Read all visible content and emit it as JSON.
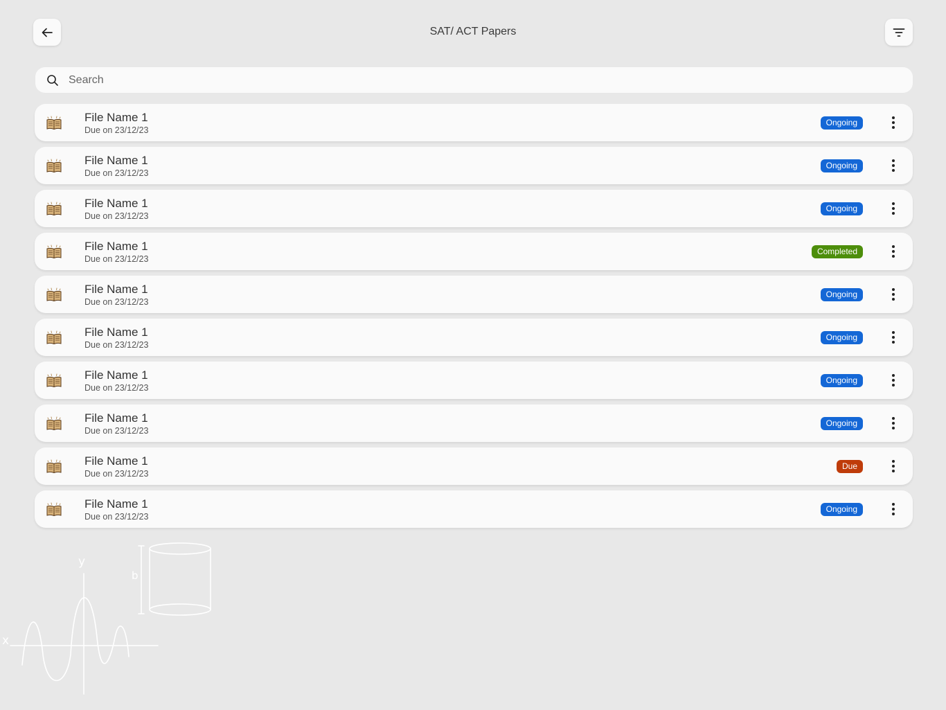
{
  "header": {
    "title": "SAT/ ACT Papers",
    "back_icon": "arrow-left-icon",
    "filter_icon": "filter-icon"
  },
  "search": {
    "placeholder": "Search",
    "value": ""
  },
  "status_colors": {
    "Ongoing": "#1467d6",
    "Completed": "#4d8e0b",
    "Due": "#bf3c0a"
  },
  "files": [
    {
      "name": "File Name 1",
      "due": "Due on 23/12/23",
      "status": "Ongoing"
    },
    {
      "name": "File Name 1",
      "due": "Due on 23/12/23",
      "status": "Ongoing"
    },
    {
      "name": "File Name 1",
      "due": "Due on 23/12/23",
      "status": "Ongoing"
    },
    {
      "name": "File Name 1",
      "due": "Due on 23/12/23",
      "status": "Completed"
    },
    {
      "name": "File Name 1",
      "due": "Due on 23/12/23",
      "status": "Ongoing"
    },
    {
      "name": "File Name 1",
      "due": "Due on 23/12/23",
      "status": "Ongoing"
    },
    {
      "name": "File Name 1",
      "due": "Due on 23/12/23",
      "status": "Ongoing"
    },
    {
      "name": "File Name 1",
      "due": "Due on 23/12/23",
      "status": "Ongoing"
    },
    {
      "name": "File Name 1",
      "due": "Due on 23/12/23",
      "status": "Due"
    },
    {
      "name": "File Name 1",
      "due": "Due on 23/12/23",
      "status": "Ongoing"
    }
  ],
  "decoration": {
    "axis_x": "x",
    "axis_y": "y",
    "cylinder_label": "b"
  }
}
